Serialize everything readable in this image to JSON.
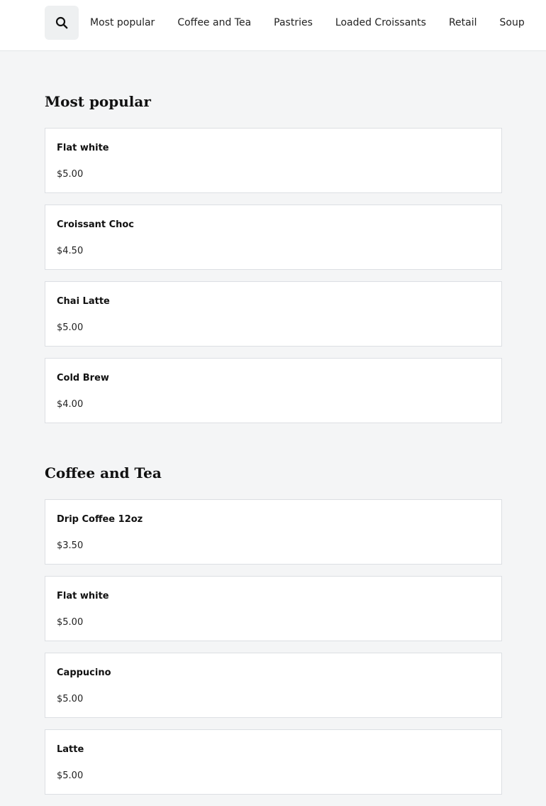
{
  "header": {
    "search_icon": "search-icon",
    "nav": [
      {
        "label": "Most popular"
      },
      {
        "label": "Coffee and Tea"
      },
      {
        "label": "Pastries"
      },
      {
        "label": "Loaded Croissants"
      },
      {
        "label": "Retail"
      },
      {
        "label": "Soup"
      }
    ]
  },
  "sections": [
    {
      "title": "Most popular",
      "items": [
        {
          "name": "Flat white",
          "price": "$5.00"
        },
        {
          "name": "Croissant Choc",
          "price": "$4.50"
        },
        {
          "name": "Chai Latte",
          "price": "$5.00"
        },
        {
          "name": "Cold Brew",
          "price": "$4.00"
        }
      ]
    },
    {
      "title": "Coffee and Tea",
      "items": [
        {
          "name": "Drip Coffee 12oz",
          "price": "$3.50"
        },
        {
          "name": "Flat white",
          "price": "$5.00"
        },
        {
          "name": "Cappucino",
          "price": "$5.00"
        },
        {
          "name": "Latte",
          "price": "$5.00"
        }
      ]
    }
  ]
}
